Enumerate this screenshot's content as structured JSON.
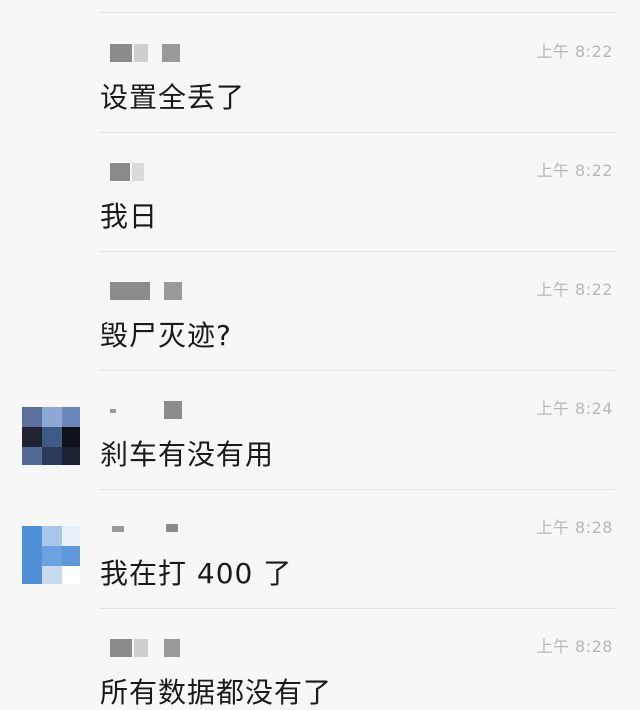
{
  "messages": [
    {
      "time": "上午 8:22",
      "text": "设置全丢了",
      "has_avatar": false
    },
    {
      "time": "上午 8:22",
      "text": "我日",
      "has_avatar": false
    },
    {
      "time": "上午 8:22",
      "text": "毁尸灭迹?",
      "has_avatar": false
    },
    {
      "time": "上午 8:24",
      "text": "刹车有没有用",
      "has_avatar": true
    },
    {
      "time": "上午 8:28",
      "text": "我在打 400 了",
      "has_avatar": true
    },
    {
      "time": "上午 8:28",
      "text": "所有数据都没有了",
      "has_avatar": false
    }
  ]
}
